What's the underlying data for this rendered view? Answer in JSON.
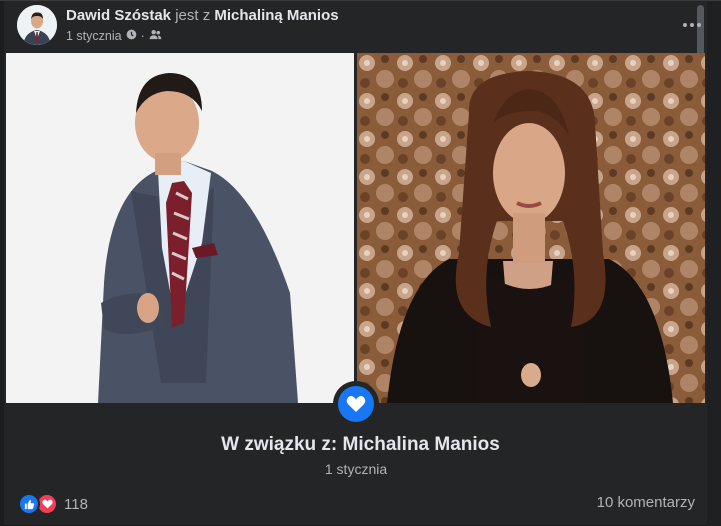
{
  "post": {
    "author": "Dawid Szóstak",
    "connector": "jest z",
    "partner": "Michaliną Manios",
    "date": "1 stycznia",
    "privacy_icon": "friends-icon",
    "clock_icon": "clock-icon"
  },
  "relationship": {
    "title": "W związku z: Michalina Manios",
    "date": "1 stycznia",
    "badge_icon": "heart-icon",
    "badge_color": "#1877f2"
  },
  "footer": {
    "reaction_count": "118",
    "comments_label": "10 komentarzy",
    "like_color": "#1877f2",
    "love_color": "#f33e58"
  }
}
